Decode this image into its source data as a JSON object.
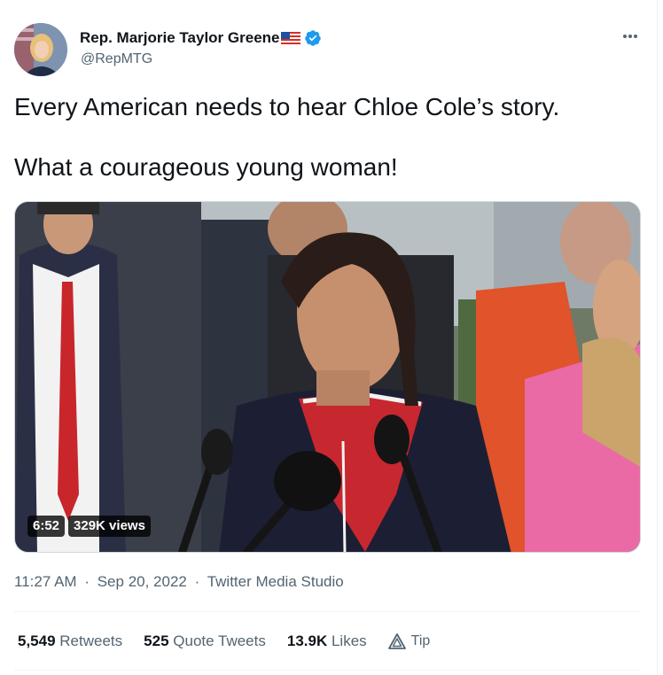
{
  "author": {
    "name": "Rep. Marjorie Taylor Greene",
    "flag_emoji": "🇺🇸",
    "handle": "@RepMTG",
    "verified": true
  },
  "tweet": {
    "lines": [
      "Every American needs to hear Chloe Cole’s story.",
      "What a courageous young woman!"
    ]
  },
  "video": {
    "duration": "6:52",
    "views": "329K views"
  },
  "meta": {
    "time": "11:27 AM",
    "separator": "·",
    "date": "Sep 20, 2022",
    "source": "Twitter Media Studio"
  },
  "stats": {
    "retweets_count": "5,549",
    "retweets_label": "Retweets",
    "quotes_count": "525",
    "quotes_label": "Quote Tweets",
    "likes_count": "13.9K",
    "likes_label": "Likes",
    "tip_label": "Tip"
  },
  "colors": {
    "verified_blue": "#1d9bf0",
    "secondary_text": "#536471",
    "primary_text": "#0f1419"
  }
}
